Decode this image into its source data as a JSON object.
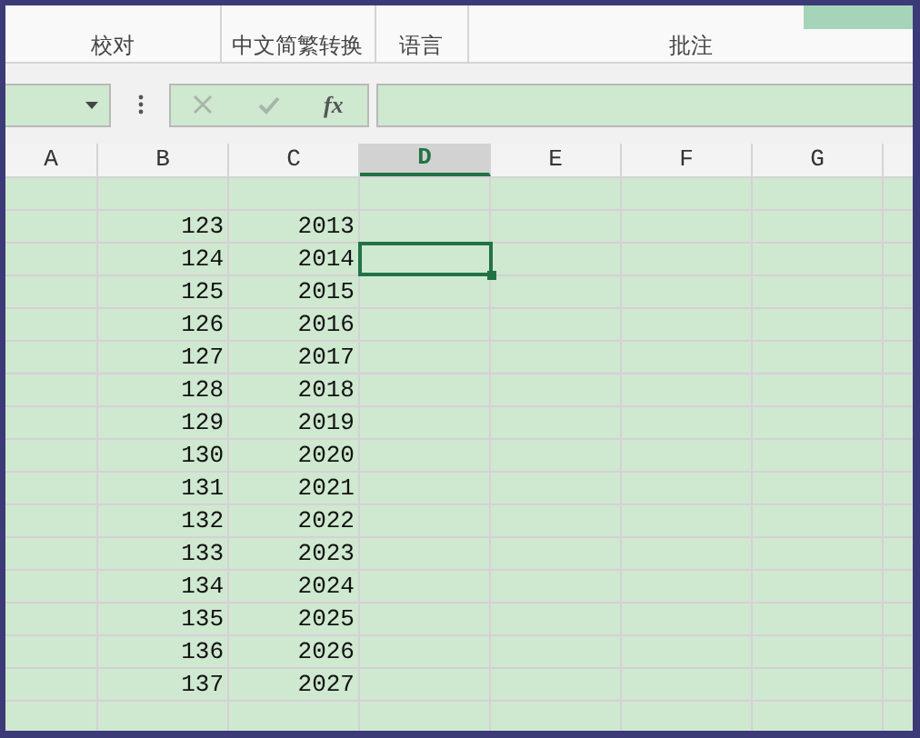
{
  "ribbon": {
    "groups": [
      {
        "label": "校对"
      },
      {
        "label": "中文简繁转换"
      },
      {
        "label": "语言"
      },
      {
        "label": "批注"
      }
    ]
  },
  "formula_bar": {
    "function_button": "fx",
    "cancel_disabled": true,
    "confirm_disabled": true
  },
  "columns": [
    {
      "label": "A",
      "selected": false
    },
    {
      "label": "B",
      "selected": false
    },
    {
      "label": "C",
      "selected": false
    },
    {
      "label": "D",
      "selected": true
    },
    {
      "label": "E",
      "selected": false
    },
    {
      "label": "F",
      "selected": false
    },
    {
      "label": "G",
      "selected": false
    }
  ],
  "rows": [
    {
      "b": "123",
      "c": "2013",
      "selected": false
    },
    {
      "b": "124",
      "c": "2014",
      "selected": true
    },
    {
      "b": "125",
      "c": "2015",
      "selected": false
    },
    {
      "b": "126",
      "c": "2016",
      "selected": false
    },
    {
      "b": "127",
      "c": "2017",
      "selected": false
    },
    {
      "b": "128",
      "c": "2018",
      "selected": false
    },
    {
      "b": "129",
      "c": "2019",
      "selected": false
    },
    {
      "b": "130",
      "c": "2020",
      "selected": false
    },
    {
      "b": "131",
      "c": "2021",
      "selected": false
    },
    {
      "b": "132",
      "c": "2022",
      "selected": false
    },
    {
      "b": "133",
      "c": "2023",
      "selected": false
    },
    {
      "b": "134",
      "c": "2024",
      "selected": false
    },
    {
      "b": "135",
      "c": "2025",
      "selected": false
    },
    {
      "b": "136",
      "c": "2026",
      "selected": false
    },
    {
      "b": "137",
      "c": "2027",
      "selected": false
    }
  ]
}
